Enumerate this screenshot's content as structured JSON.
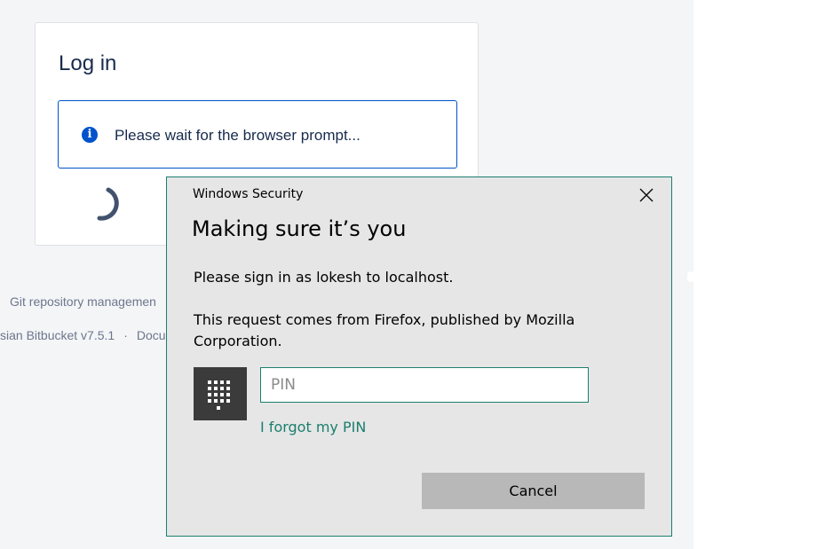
{
  "login": {
    "title": "Log in",
    "info_message": "Please wait for the browser prompt...",
    "info_icon": "info-icon"
  },
  "footer": {
    "line1": "Git repository managemen",
    "line2_product": "sian Bitbucket v7.5.1",
    "line2_separator": "·",
    "line2_link": "Docu"
  },
  "dialog": {
    "caption": "Windows Security",
    "close_icon": "close-icon",
    "heading": "Making sure it’s you",
    "line1": "Please sign in as lokesh to localhost.",
    "line2": "This request comes from Firefox, published by Mozilla Corporation.",
    "pin_icon": "keypad-icon",
    "pin_placeholder": "PIN",
    "pin_value": "",
    "forgot_link": "I forgot my PIN",
    "cancel_label": "Cancel"
  },
  "colors": {
    "page_bg": "#f4f5f7",
    "atlassian_blue": "#0052cc",
    "text_dark": "#172b4d",
    "text_muted": "#6b778c",
    "windows_accent": "#1a7f6e",
    "dialog_bg": "#e6e6e6",
    "button_bg": "#b8b8b8",
    "pin_tile_bg": "#3b3b3b"
  }
}
